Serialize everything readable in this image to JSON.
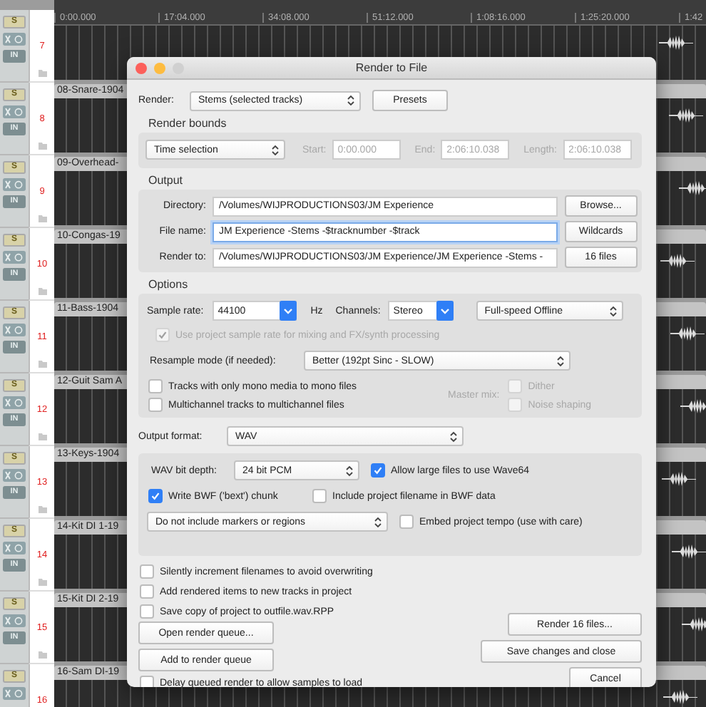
{
  "ruler": {
    "times": [
      "0:00.000",
      "17:04.000",
      "34:08.000",
      "51:12.000",
      "1:08:16.000",
      "1:25:20.000",
      "1:42"
    ]
  },
  "tracks": [
    {
      "number": "7",
      "solo": "S",
      "input": "IN"
    },
    {
      "number": "8",
      "name": "08-Snare-1904",
      "solo": "S",
      "input": "IN"
    },
    {
      "number": "9",
      "name": "09-Overhead-",
      "solo": "S",
      "input": "IN"
    },
    {
      "number": "10",
      "name": "10-Congas-19",
      "solo": "S",
      "input": "IN"
    },
    {
      "number": "11",
      "name": "11-Bass-1904",
      "solo": "S",
      "input": "IN"
    },
    {
      "number": "12",
      "name": "12-Guit Sam A",
      "solo": "S",
      "input": "IN"
    },
    {
      "number": "13",
      "name": "13-Keys-1904",
      "solo": "S",
      "input": "IN"
    },
    {
      "number": "14",
      "name": "14-Kit DI 1-19",
      "solo": "S",
      "input": "IN"
    },
    {
      "number": "15",
      "name": "15-Kit DI 2-19",
      "solo": "S",
      "input": "IN"
    },
    {
      "number": "16",
      "name": "16-Sam DI-19",
      "solo": "S"
    }
  ],
  "dialog": {
    "title": "Render to File",
    "render": {
      "label": "Render:",
      "value": "Stems (selected tracks)"
    },
    "presets_button": "Presets",
    "bounds": {
      "heading": "Render bounds",
      "value": "Time selection",
      "disabled": true,
      "fields": [
        {
          "label": "Start:",
          "value": "0:00.000"
        },
        {
          "label": "End:",
          "value": "2:06:10.038"
        },
        {
          "label": "Length:",
          "value": "2:06:10.038"
        }
      ]
    },
    "output": {
      "heading": "Output",
      "rows": [
        {
          "label": "Directory:",
          "value": "/Volumes/WIJPRODUCTIONS03/JM Experience",
          "focused": false,
          "button": "Browse..."
        },
        {
          "label": "File name:",
          "value": "JM Experience -Stems -$tracknumber -$track",
          "focused": true,
          "button": "Wildcards"
        },
        {
          "label": "Render to:",
          "value": "/Volumes/WIJPRODUCTIONS03/JM Experience/JM Experience -Stems -",
          "focused": false,
          "button": "16 files"
        }
      ]
    },
    "options": {
      "heading": "Options",
      "sample_rate_label": "Sample rate:",
      "sample_rate": "44100",
      "hz": "Hz",
      "channels_label": "Channels:",
      "channels": "Stereo",
      "mode": "Full-speed Offline",
      "project_rate": {
        "label": "Use project sample rate for mixing and FX/synth processing",
        "checked": true,
        "disabled": true
      },
      "resample_label": "Resample mode (if needed):",
      "resample": "Better (192pt Sinc - SLOW)",
      "checks": [
        {
          "label": "Tracks with only mono media to mono files",
          "checked": false,
          "disabled": false
        },
        {
          "label": "Multichannel tracks to multichannel files",
          "checked": false,
          "disabled": false
        }
      ],
      "master_mix_label": "Master mix:",
      "master_checks": [
        {
          "label": "Dither",
          "checked": false,
          "disabled": true
        },
        {
          "label": "Noise shaping",
          "checked": false,
          "disabled": true
        }
      ]
    },
    "format": {
      "label": "Output format:",
      "value": "WAV"
    },
    "wav": {
      "bit_depth_label": "WAV bit depth:",
      "bit_depth": "24 bit PCM",
      "markers": "Do not include markers or regions",
      "checks": [
        {
          "label": "Allow large files to use Wave64",
          "checked": true,
          "disabled": false
        },
        {
          "label": "Write BWF ('bext') chunk",
          "checked": true,
          "disabled": false
        },
        {
          "label": "Include project filename in BWF data",
          "checked": false,
          "disabled": false
        },
        {
          "label": "Embed project tempo (use with care)",
          "checked": false,
          "disabled": false
        }
      ]
    },
    "extra_checks": [
      {
        "label": "Silently increment filenames to avoid overwriting",
        "checked": false,
        "disabled": false
      },
      {
        "label": "Add rendered items to new tracks in project",
        "checked": false,
        "disabled": false
      },
      {
        "label": "Save copy of project to outfile.wav.RPP",
        "checked": false,
        "disabled": false
      }
    ],
    "queue_buttons": [
      "Open render queue...",
      "Add to render queue"
    ],
    "delay_check": {
      "label": "Delay queued render to allow samples to load",
      "checked": false,
      "disabled": false
    },
    "action_buttons": [
      "Render 16 files...",
      "Save changes and close",
      "Cancel"
    ]
  }
}
